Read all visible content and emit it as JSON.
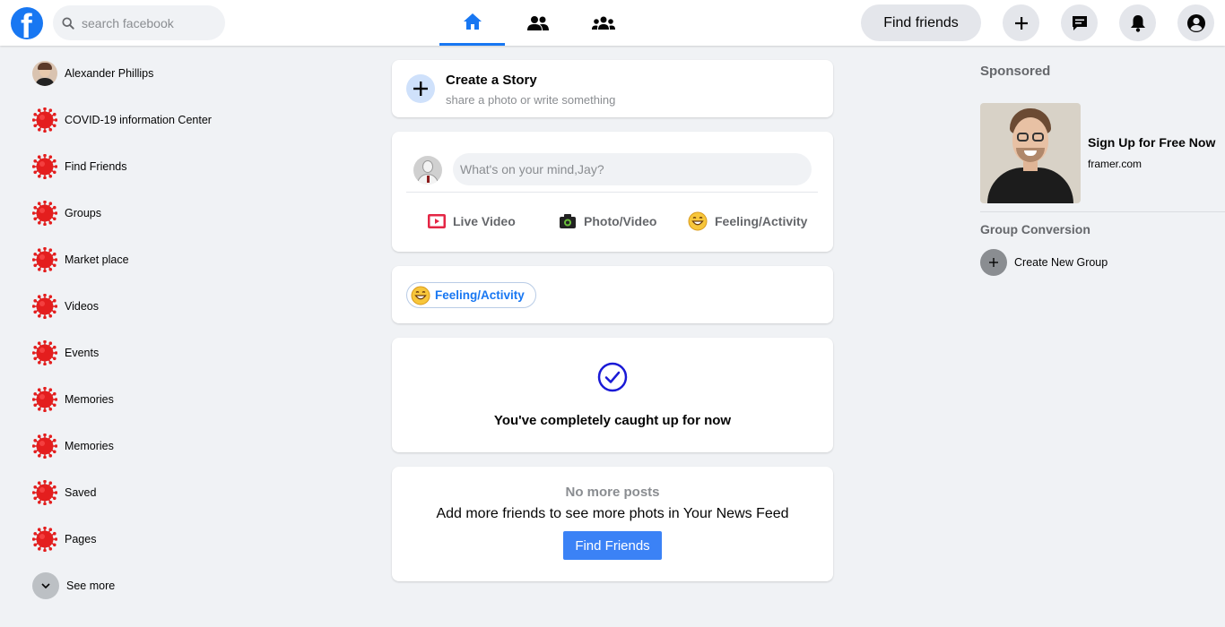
{
  "topbar": {
    "logo_letter": "f",
    "search_placeholder": "search facebook",
    "tabs": [
      "home",
      "friends",
      "groups"
    ],
    "find_friends_label": "Find friends",
    "icons": [
      "plus-icon",
      "messenger-icon",
      "bell-icon",
      "account-icon"
    ]
  },
  "sidebar": {
    "profile_name": "Alexander Phillips",
    "items": [
      {
        "label": "COVID-19 information Center"
      },
      {
        "label": "Find Friends"
      },
      {
        "label": "Groups"
      },
      {
        "label": "Market place"
      },
      {
        "label": "Videos"
      },
      {
        "label": "Events"
      },
      {
        "label": "Memories"
      },
      {
        "label": "Memories"
      },
      {
        "label": "Saved"
      },
      {
        "label": "Pages"
      }
    ],
    "see_more_label": "See more"
  },
  "story": {
    "title": "Create a Story",
    "subtitle": "share a photo or write something"
  },
  "composer": {
    "placeholder": "What's on your mind,Jay?",
    "actions": {
      "live": "Live Video",
      "photo": "Photo/Video",
      "feeling": "Feeling/Activity"
    }
  },
  "feeling_card": {
    "label": "Feeling/Activity"
  },
  "caught_up": {
    "message": "You've completely caught up for now"
  },
  "no_posts": {
    "title": "No more posts",
    "subtitle": "Add more friends to see more phots in Your News Feed",
    "button_label": "Find Friends"
  },
  "right": {
    "sponsored_title": "Sponsored",
    "ad_headline": "Sign Up for Free Now",
    "ad_domain": "framer.com",
    "group_title": "Group Conversion",
    "create_group_label": "Create New Group"
  },
  "colors": {
    "brand": "#1877f2",
    "background": "#f0f2f5",
    "virus_red": "#e41e1e",
    "check_blue": "#1a1ad6"
  }
}
